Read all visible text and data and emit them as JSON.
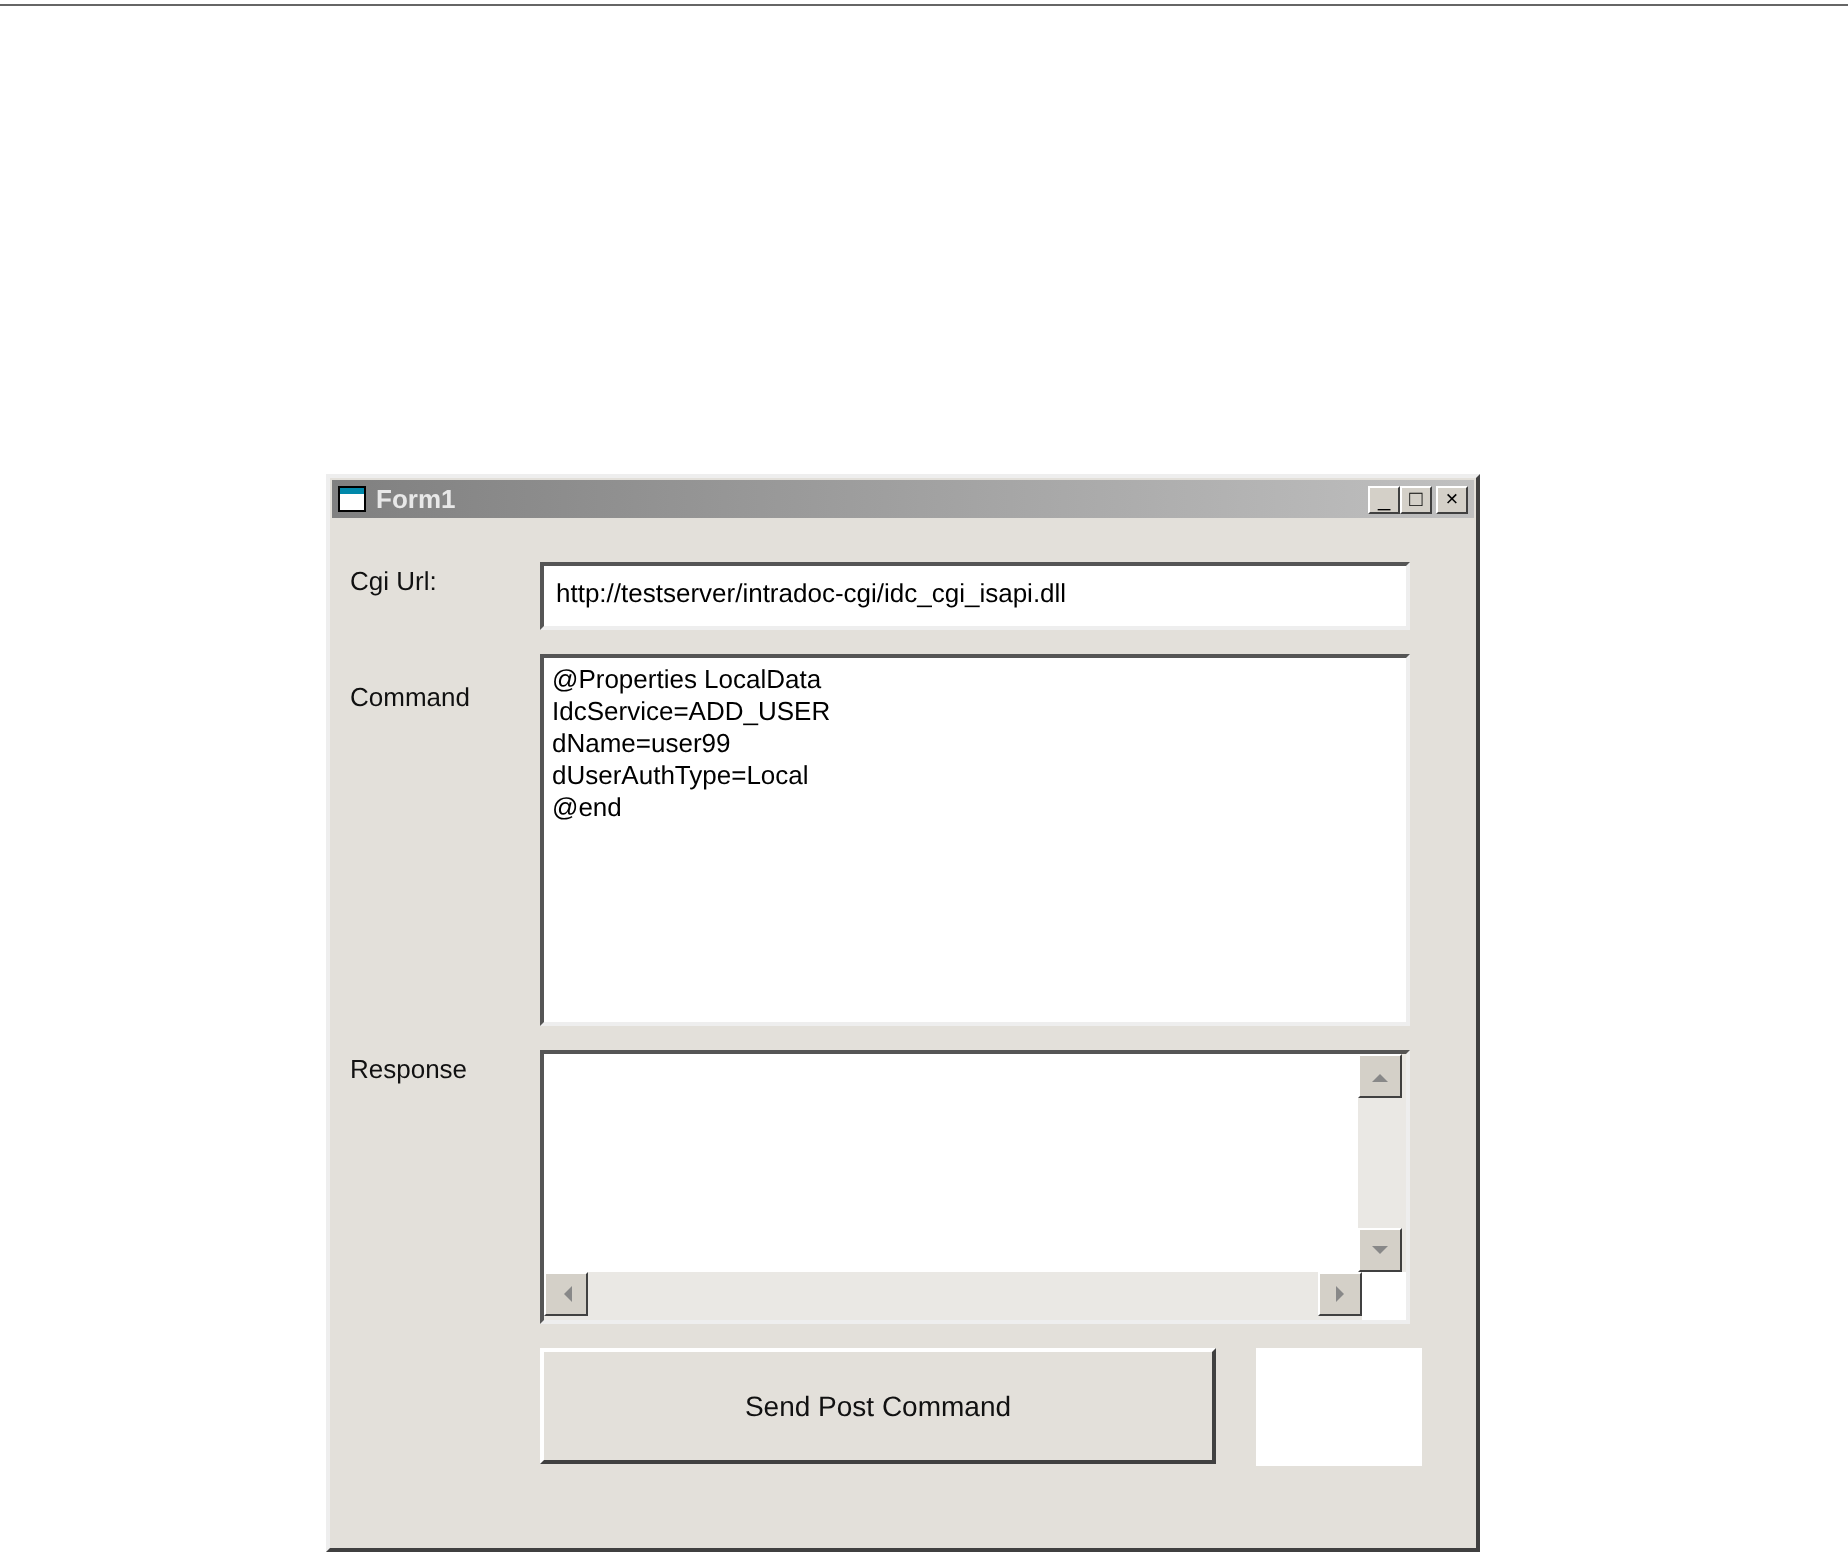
{
  "window": {
    "title": "Form1",
    "controls": [
      "_",
      "□",
      "×"
    ]
  },
  "fields": [
    {
      "kind": "line",
      "label": "Cgi Url:",
      "value": "http://testserver/intradoc-cgi/idc_cgi_isapi.dll"
    },
    {
      "kind": "multiline",
      "label": "Command",
      "lines": [
        "@Properties LocalData",
        "IdcService=ADD_USER",
        "dName=user99",
        "dUserAuthType=Local",
        "@end"
      ]
    },
    {
      "kind": "scroll",
      "label": "Response"
    }
  ],
  "button": "Send Post Command"
}
